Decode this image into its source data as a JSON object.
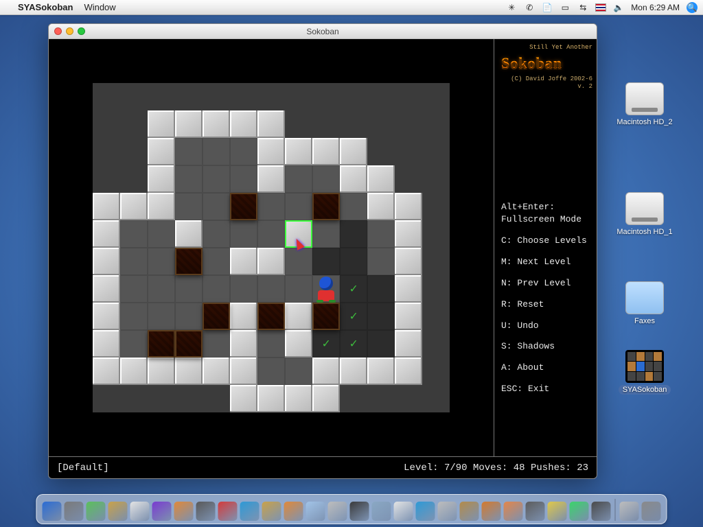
{
  "menubar": {
    "app_name": "SYASokoban",
    "menus": [
      "Window"
    ],
    "clock": "Mon 6:29 AM"
  },
  "desktop": {
    "icons": [
      {
        "label": "Macintosh HD_2",
        "kind": "hd"
      },
      {
        "label": "Macintosh HD_1",
        "kind": "hd"
      },
      {
        "label": "Faxes",
        "kind": "folder"
      },
      {
        "label": "SYASokoban",
        "kind": "app",
        "selected": true
      }
    ]
  },
  "window": {
    "title": "Sokoban"
  },
  "game": {
    "logo_sub": "Still Yet Another",
    "logo": "Sokoban",
    "copyright": "(C) David Joffe 2002-6",
    "version": "v. 2",
    "help": [
      "Alt+Enter:\nFullscreen Mode",
      "C: Choose Levels",
      "M: Next Level",
      "N: Prev Level",
      "R: Reset",
      "U: Undo",
      "S: Shadows",
      "A: About",
      "ESC: Exit"
    ],
    "status_left": "[Default]",
    "status_right": "Level: 7/90 Moves: 48 Pushes: 23",
    "level_info": {
      "set": "Default",
      "level": 7,
      "total_levels": 90,
      "moves": 48,
      "pushes": 23
    }
  },
  "level_map": {
    "tile_size_px": 40,
    "cols": 13,
    "rows": 12,
    "legend": {
      ".": "outside",
      "#": "wall",
      " ": "floor",
      "d": "dark-floor",
      "g": "goal-on-dark"
    },
    "rows_data": [
      ".............",
      "..#####......",
      "..#   ####...",
      "..#   #  ##..",
      "###     d ##.",
      "#  #   # d #.",
      "#  # ## dd #.",
      "#        gd#.",
      "#   ## #dgd#.",
      "#    # #ggd#.",
      "######  ####.",
      ".....####....",
      "............."
    ],
    "crates": [
      {
        "c": 5,
        "r": 4
      },
      {
        "c": 8,
        "r": 4
      },
      {
        "c": 3,
        "r": 6
      },
      {
        "c": 4,
        "r": 8
      },
      {
        "c": 6,
        "r": 8
      },
      {
        "c": 8,
        "r": 8
      },
      {
        "c": 2,
        "r": 9
      },
      {
        "c": 3,
        "r": 9
      }
    ],
    "player": {
      "c": 8,
      "r": 7
    },
    "highlight": {
      "c": 7,
      "r": 5
    },
    "cursor": {
      "c": 7,
      "r": 5
    }
  },
  "dock": {
    "count": 26,
    "colors": [
      "#2b6cd4",
      "#7a7a7a",
      "#5cc05c",
      "#c9a24a",
      "#e4e4e4",
      "#7a3bd1",
      "#e0893a",
      "#595959",
      "#d43b3b",
      "#2e9ad6",
      "#c9a24a",
      "#e0893a",
      "#a2c4e8",
      "#bdbdbd",
      "#3a3a3a",
      "#8aa8c4",
      "#e4e4e4",
      "#2e9ad6",
      "#bdbdbd",
      "#b38b4a",
      "#d47a2e",
      "#e4864a",
      "#5c5c5c",
      "#e0c84a",
      "#3bd46b",
      "#4a4a4a"
    ],
    "right": [
      "#bdbdbd",
      "#8a8a8a"
    ]
  }
}
